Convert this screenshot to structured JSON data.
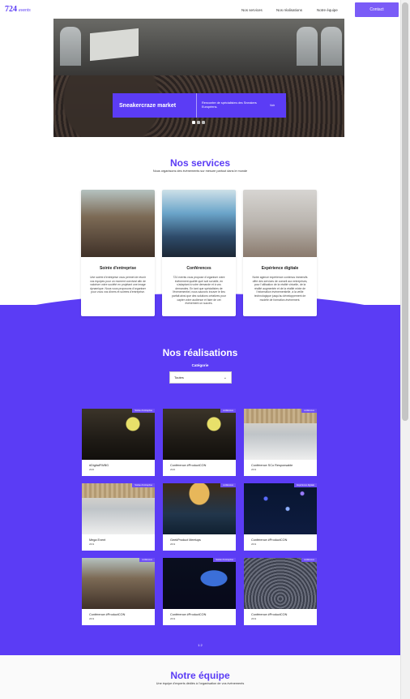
{
  "header": {
    "logo": "724",
    "logo_sub": "events",
    "nav": [
      "Nos services",
      "Nos réalisations",
      "Notre équipe"
    ],
    "contact": "Contact"
  },
  "hero": {
    "title": "Sneakercraze market",
    "description": "Rencontre de spécialistes des Sneakers Européens.",
    "more": "Voir",
    "slides": 3,
    "active_slide": 1
  },
  "services": {
    "title": "Nos services",
    "subtitle": "Nous organisons des événements sur mesure partout dans le monde",
    "items": [
      {
        "name": "Soirée d'entreprise",
        "text": "Une soirée d'entreprise vous permet de réunir vos équipes pour un moment convivial afin de valoriser votre société en projetant une image dynamique. Nous vous proposons d'organiser pour vous vos dîners et soirées d'entreprise.",
        "image": "party"
      },
      {
        "name": "Conférences",
        "text": "724 events vous propose d'organiser votre événement qualité quel soit sa taille, en s'adaptant à votre demande et à vos demandes. En tant que spécialistes de l'événementiel, nous saurons trouver le lieu parfait ainsi que des solutions créatives pour capter votre audience et faire de cet événement un succès.",
        "image": "conf"
      },
      {
        "name": "Expérience digitale",
        "text": "Notre agence expérience contenus immersifs offre des services de conseil aux entreprises, pour l'utilisation de la réalité virtuelle, de la réalité augmentée et de la réalité mixte de l'information événementielle, à la veille technologique jusqu'au développement de modèle de formation-évènement.",
        "image": "vr"
      }
    ]
  },
  "realisations": {
    "title": "Nos réalisations",
    "category_label": "Catégorie",
    "select_value": "Toutes",
    "projects": [
      {
        "title": "#DigitalFWBG",
        "date": "2020",
        "tag": "Soirée d'entreprise",
        "image": "meeting"
      },
      {
        "title": "Conférence #ProductCON",
        "date": "2020",
        "tag": "conférence",
        "image": "meeting"
      },
      {
        "title": "Conférence SCo Responsable",
        "date": "2019",
        "tag": "conférence",
        "image": "hall"
      },
      {
        "title": "Mega Event",
        "date": "2019",
        "tag": "Soirée d'entreprise",
        "image": "hall"
      },
      {
        "title": "GeekProduct Meetups",
        "date": "2019",
        "tag": "conférence",
        "image": "amphi"
      },
      {
        "title": "Conférence #ProductCON",
        "date": "2019",
        "tag": "Expérience digitale",
        "image": "lights"
      },
      {
        "title": "Conférence #ProductCON",
        "date": "2019",
        "tag": "conférence",
        "image": "party"
      },
      {
        "title": "Conférence #ProductCON",
        "date": "2019",
        "tag": "Soirée d'entreprise",
        "image": "stage"
      },
      {
        "title": "Conférence #ProductCON",
        "date": "2019",
        "tag": "conférence",
        "image": "audience"
      }
    ],
    "pager": "1  2"
  },
  "team": {
    "title": "Notre équipe",
    "subtitle": "Une équipe d'experts dédiés à l'organisation de vos événements"
  },
  "colors": {
    "accent": "#5b3cf5",
    "button": "#7a5cf7"
  }
}
